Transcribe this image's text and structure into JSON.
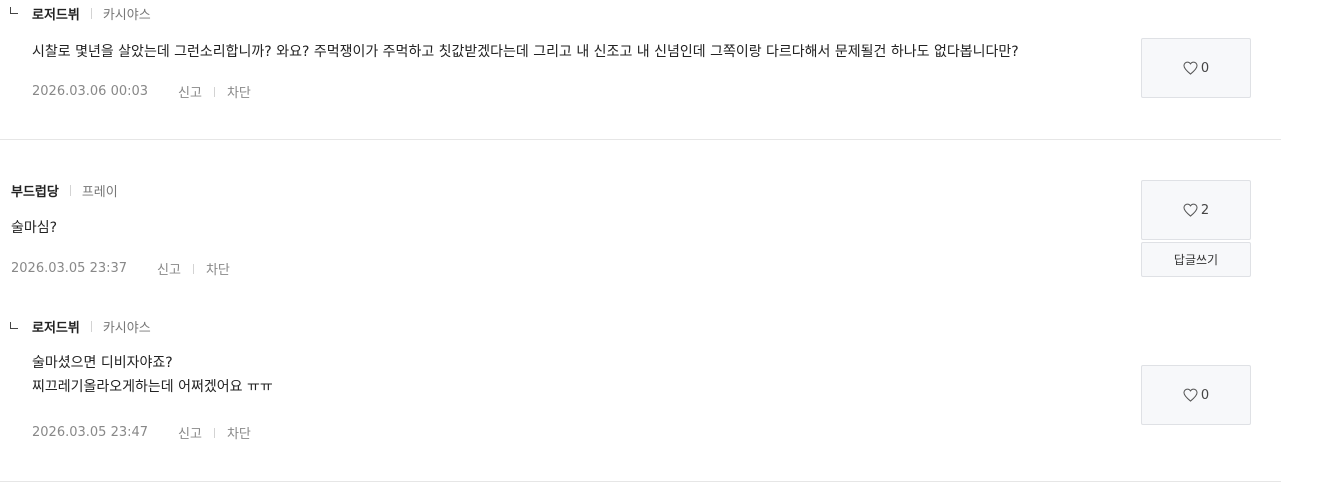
{
  "comments": [
    {
      "nickname": "로저드뷔",
      "sub": "카시야스",
      "lines": [
        "시찰로 몇년을 살았는데 그런소리합니까? 와요? 주먹쟁이가 주먹하고 칫값받겠다는데 그리고 내 신조고 내 신념인데 그쪽이랑 다르다해서 문제될건 하나도 없다봅니다만?"
      ],
      "date": "2026.03.06 00:03",
      "report": "신고",
      "block": "차단",
      "likes": "0"
    },
    {
      "nickname": "부드럽당",
      "sub": "프레이",
      "lines": [
        "술마심?"
      ],
      "date": "2026.03.05 23:37",
      "report": "신고",
      "block": "차단",
      "likes": "2",
      "reply_label": "답글쓰기"
    },
    {
      "nickname": "로저드뷔",
      "sub": "카시야스",
      "lines": [
        "술마셨으면 디비자야죠?",
        "찌끄레기올라오게하는데 어쩌겠어요 ㅠㅠ"
      ],
      "date": "2026.03.05 23:47",
      "report": "신고",
      "block": "차단",
      "likes": "0"
    }
  ]
}
